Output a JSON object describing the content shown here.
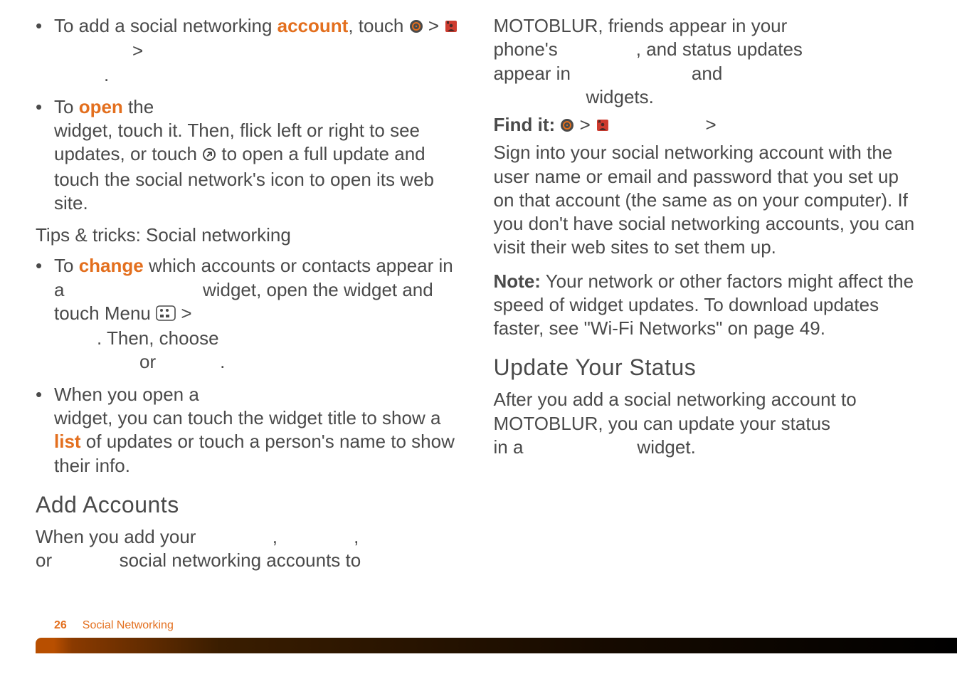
{
  "left": {
    "b1": {
      "pre": "To add a social networking ",
      "bold": "account",
      "post": ", touch "
    },
    "b2": {
      "pre": "To ",
      "bold": "open",
      "post1": " the",
      "post2": "widget, touch it. Then, flick left or right to see updates, or touch ",
      "post3": " to open a full update and touch the social network's icon to open its web site."
    },
    "tips": "Tips & tricks: Social networking",
    "b3": {
      "pre": "To ",
      "bold": "change",
      "post1": " which accounts or contacts appear in a",
      "post2": "widget, open the widget and touch Menu ",
      "then": ". Then, choose",
      "or": "or",
      "dot": "."
    },
    "b4": {
      "pre": "When you open a",
      "mid1": "widget, you can touch the widget title to show a ",
      "bold": "list",
      "mid2": " of updates or touch a person's name to show their info."
    },
    "h2": "Add Accounts",
    "para": {
      "l1": "When you add your",
      "comma1": ",",
      "comma2": ",",
      "l2a": "or",
      "l2b": "social networking accounts to"
    }
  },
  "right": {
    "top": {
      "l1": "MOTOBLUR, friends appear in your",
      "l2a": "phone's",
      "l2b": ", and status updates",
      "l3a": "appear in",
      "l3b": "and",
      "l4": "widgets."
    },
    "findit": {
      "label": "Find it:",
      "gt1": ">",
      "gt2": ">"
    },
    "p1": "Sign into your social networking account with the user name or email and password that you set up on that account (the same as on your computer). If you don't have social networking accounts, you can visit their web sites to set them up.",
    "p2": {
      "bold": "Note:",
      "rest": " Your network or other factors might affect the speed of widget updates. To download updates faster, see \"Wi-Fi Networks\" on page 49."
    },
    "h2": "Update Your Status",
    "p3": {
      "l1": "After you add a social networking account to MOTOBLUR, you can update your status",
      "l2a": "in a",
      "l2b": "widget."
    }
  },
  "footer": {
    "page": "26",
    "section": "Social Networking"
  }
}
